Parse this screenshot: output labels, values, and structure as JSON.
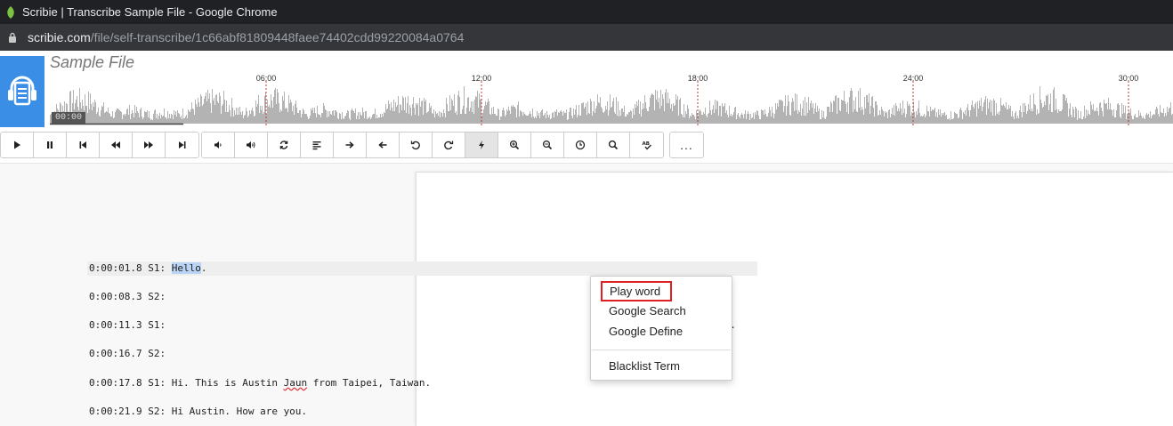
{
  "browser": {
    "window_title": "Scribie | Transcribe Sample File - Google Chrome",
    "url_host": "scribie.com",
    "url_path": "/file/self-transcribe/1c66abf81809448faee74402cdd99220084a0764"
  },
  "header": {
    "file_title": "Sample File",
    "timecode": "00:00",
    "timeline_markers": [
      "06:00",
      "12:00",
      "18:00",
      "24:00",
      "30:00"
    ]
  },
  "toolbar": {
    "more_label": "..."
  },
  "transcript": {
    "lines": [
      {
        "time": "0:00:01.8",
        "speaker": "S1:",
        "selected": "Hello",
        "rest": "."
      },
      {
        "time": "0:00:08.3",
        "speaker": "S2:",
        "text": ""
      },
      {
        "time": "0:00:11.3",
        "speaker": "S1:",
        "text": "me."
      },
      {
        "time": "0:00:16.7",
        "speaker": "S2:",
        "text": ""
      },
      {
        "time": "0:00:17.8",
        "speaker": "S1:",
        "pre": "Hi. This is Austin ",
        "flagged": "Jaun",
        "post": " from Taipei, Taiwan."
      },
      {
        "time": "0:00:21.9",
        "speaker": "S2:",
        "text": "Hi Austin. How are you."
      }
    ]
  },
  "context_menu": {
    "play_word": "Play word",
    "google_search": "Google Search",
    "google_define": "Google Define",
    "blacklist_term": "Blacklist Term"
  },
  "colors": {
    "logo_bg": "#3a8ee6",
    "waveform": "#b3b3b3",
    "marker": "#c0392b",
    "highlight_border": "#e02020"
  }
}
